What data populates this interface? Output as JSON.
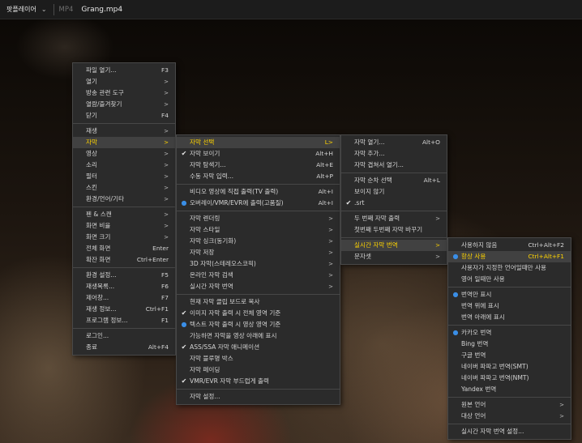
{
  "topbar": {
    "app_name": "팟플레이어",
    "format": "MP4",
    "file_name": "Grang.mp4"
  },
  "menu1": [
    {
      "label": "파일 열기...",
      "shortcut": "F3"
    },
    {
      "label": "열기",
      "arrow": ">"
    },
    {
      "label": "방송 관련 도구",
      "arrow": ">"
    },
    {
      "label": "열람/즐겨찾기",
      "arrow": ">"
    },
    {
      "label": "닫기",
      "shortcut": "F4"
    },
    {
      "divider": true
    },
    {
      "label": "재생",
      "arrow": ">"
    },
    {
      "label": "자막",
      "arrow": ">",
      "highlight": true
    },
    {
      "label": "영상",
      "arrow": ">"
    },
    {
      "label": "소리",
      "arrow": ">"
    },
    {
      "label": "필터",
      "arrow": ">"
    },
    {
      "label": "스킨",
      "arrow": ">"
    },
    {
      "label": "환경/언어/기타",
      "arrow": ">"
    },
    {
      "divider": true
    },
    {
      "label": "펜 & 스캔",
      "arrow": ">"
    },
    {
      "label": "화면 비율",
      "arrow": ">"
    },
    {
      "label": "화면 크기",
      "arrow": ">"
    },
    {
      "label": "전체 화면",
      "shortcut": "Enter"
    },
    {
      "label": "확잔 화면",
      "shortcut": "Ctrl+Enter"
    },
    {
      "divider": true
    },
    {
      "label": "환경 설정...",
      "shortcut": "F5"
    },
    {
      "label": "재생목록...",
      "shortcut": "F6"
    },
    {
      "label": "제어창...",
      "shortcut": "F7"
    },
    {
      "label": "재생 정보...",
      "shortcut": "Ctrl+F1"
    },
    {
      "label": "프로그램 정보...",
      "shortcut": "F1"
    },
    {
      "divider": true
    },
    {
      "label": "로그인..."
    },
    {
      "label": "종료",
      "shortcut": "Alt+F4"
    }
  ],
  "menu2": [
    {
      "label": "자막 선택",
      "shortcut": "L>",
      "highlight": true
    },
    {
      "label": "자막 보이기",
      "shortcut": "Alt+H",
      "mark": "check"
    },
    {
      "label": "자막 탐색기...",
      "shortcut": "Alt+E"
    },
    {
      "label": "수동 자막 입력...",
      "shortcut": "Alt+P"
    },
    {
      "divider": true
    },
    {
      "label": "비디오 영상에 직접 출력(TV 출력)",
      "shortcut": "Alt+I"
    },
    {
      "label": "오버레이/VMR/EVR에 출력(고품질)",
      "shortcut": "Alt+I",
      "mark": "dot"
    },
    {
      "divider": true
    },
    {
      "label": "자막 렌더링",
      "arrow": ">"
    },
    {
      "label": "자막 스타일",
      "arrow": ">"
    },
    {
      "label": "자막 싱크(동기화)",
      "arrow": ">"
    },
    {
      "label": "자막 저장",
      "arrow": ">"
    },
    {
      "label": "3D 자막(스테레오스코픽)",
      "arrow": ">"
    },
    {
      "label": "온라인 자막 검색",
      "arrow": ">"
    },
    {
      "label": "실시간 자막 번역",
      "arrow": ">"
    },
    {
      "divider": true
    },
    {
      "label": "현재 자막 클립 보드로 복사"
    },
    {
      "label": "이미지 자막 출력 시 전체 영역 기준",
      "mark": "check"
    },
    {
      "label": "텍스트 자막 출력 시 영상 영역 기준",
      "mark": "dot"
    },
    {
      "label": "가능하면 자막을 영상 아래에 표시"
    },
    {
      "label": "ASS/SSA 자막 애니메이션",
      "mark": "check"
    },
    {
      "label": "자막 블루명 박스"
    },
    {
      "label": "자막 페이딩"
    },
    {
      "label": "VMR/EVR 자막 부드럽게 출력",
      "mark": "check"
    },
    {
      "divider": true
    },
    {
      "label": "자막 설정..."
    }
  ],
  "menu3": [
    {
      "label": "자막 열기...",
      "shortcut": "Alt+O"
    },
    {
      "label": "자막 추가..."
    },
    {
      "label": "자막 겹쳐서 열기..."
    },
    {
      "divider": true
    },
    {
      "label": "자막 순차 선택",
      "shortcut": "Alt+L"
    },
    {
      "label": "보이지 않기"
    },
    {
      "label": ".srt",
      "mark": "check"
    },
    {
      "divider": true
    },
    {
      "label": "두 번째 자막 출력",
      "arrow": ">"
    },
    {
      "label": "첫번째 두번째 자막 바꾸기"
    },
    {
      "divider": true
    },
    {
      "label": "실시간 자막 번역",
      "arrow": ">",
      "highlight": true
    },
    {
      "label": "문자셋",
      "arrow": ">"
    }
  ],
  "menu4": [
    {
      "label": "사용하지 않음",
      "shortcut": "Ctrl+Alt+F2"
    },
    {
      "label": "항상 사용",
      "shortcut": "Ctrl+Alt+F1",
      "mark": "dot",
      "highlight": true
    },
    {
      "label": "사용자가 지정한 언어일때만 사용"
    },
    {
      "label": "영어 일때만 사용"
    },
    {
      "divider": true
    },
    {
      "label": "번역만 표시",
      "mark": "dot"
    },
    {
      "label": "번역 위에 표시"
    },
    {
      "label": "번역 아래에 표시"
    },
    {
      "divider": true
    },
    {
      "label": "카카오 번역",
      "mark": "dot"
    },
    {
      "label": "Bing 번역"
    },
    {
      "label": "구글 번역"
    },
    {
      "label": "네이버 파파고 번역(SMT)"
    },
    {
      "label": "네이버 파파고 번역(NMT)"
    },
    {
      "label": "Yandex 번역"
    },
    {
      "divider": true
    },
    {
      "label": "원본 언어",
      "arrow": ">"
    },
    {
      "label": "대상 언어",
      "arrow": ">"
    },
    {
      "divider": true
    },
    {
      "label": "실시간 자막 번역 설정..."
    }
  ],
  "icons": {
    "check": "✔",
    "dot": "●"
  }
}
